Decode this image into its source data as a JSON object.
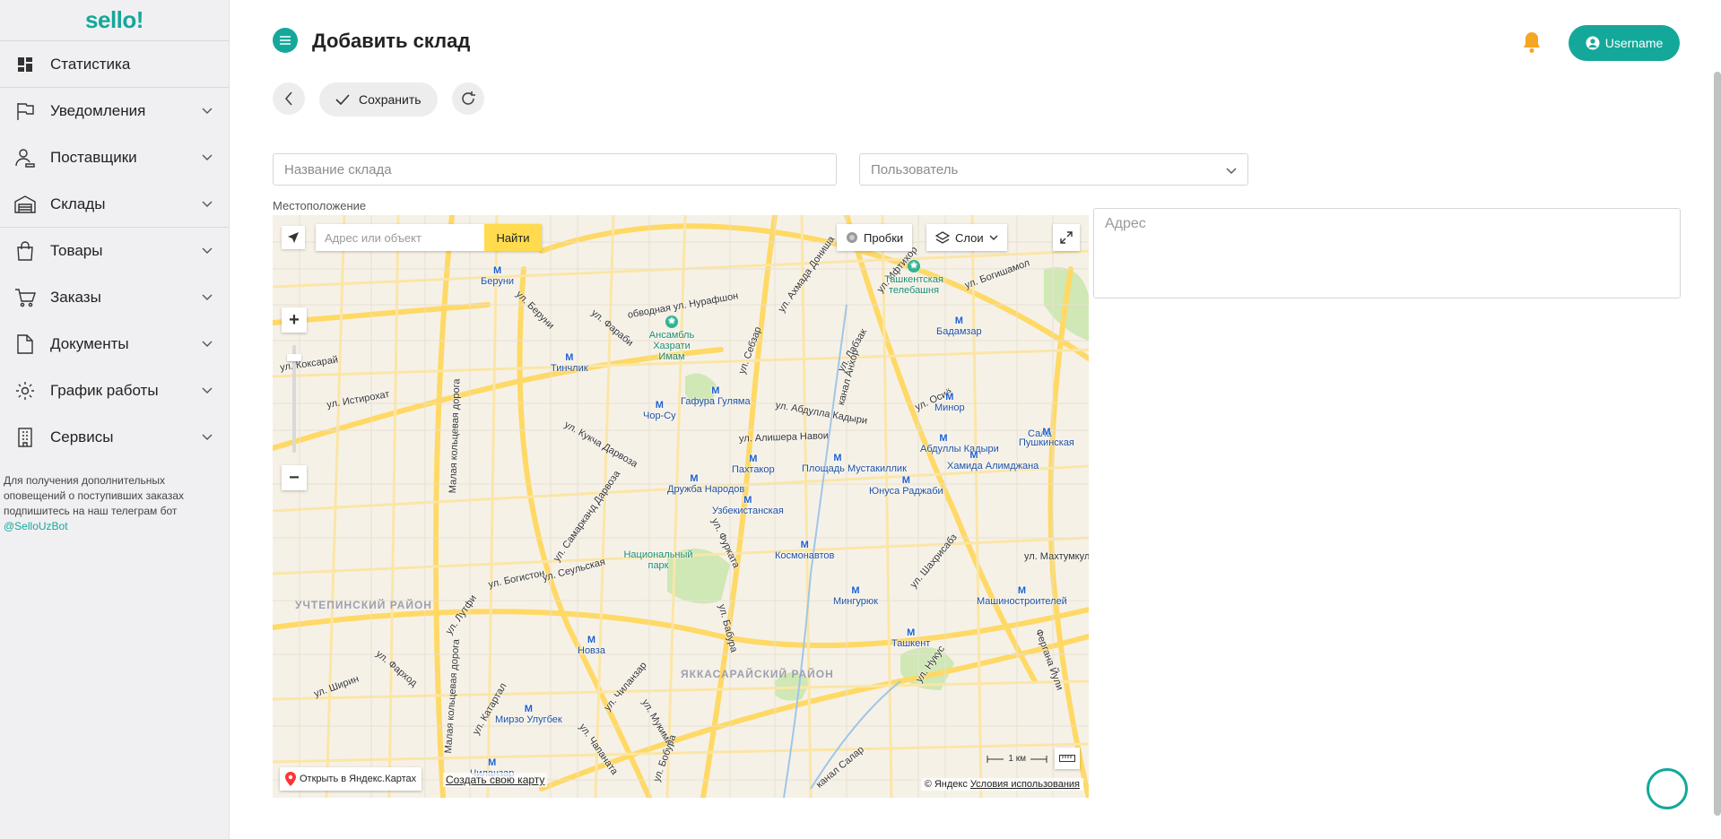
{
  "app": {
    "logo": "sello!"
  },
  "sidebar": {
    "items": [
      {
        "label": "Статистика",
        "icon": "dashboard-icon"
      },
      {
        "label": "Уведомления",
        "icon": "flag-icon"
      },
      {
        "label": "Поставщики",
        "icon": "user-hand-icon"
      },
      {
        "label": "Склады",
        "icon": "warehouse-icon"
      },
      {
        "label": "Товары",
        "icon": "shopping-bag-icon"
      },
      {
        "label": "Заказы",
        "icon": "cart-icon"
      },
      {
        "label": "Документы",
        "icon": "document-icon"
      },
      {
        "label": "График работы",
        "icon": "gear-icon"
      },
      {
        "label": "Сервисы",
        "icon": "building-icon"
      }
    ],
    "notice": "Для получения дополнительных оповещений о поступивших заказах подпишитесь на наш телеграм бот",
    "notice_link": "@SelloUzBot"
  },
  "header": {
    "title": "Добавить склад",
    "user_label": "Username"
  },
  "toolbar": {
    "save_label": "Сохранить"
  },
  "form": {
    "warehouse_name_placeholder": "Название склада",
    "user_placeholder": "Пользователь",
    "location_label": "Местоположение",
    "address_placeholder": "Адрес"
  },
  "map": {
    "search_placeholder": "Адрес или объект",
    "find_label": "Найти",
    "traffic_label": "Пробки",
    "layers_label": "Слои",
    "open_yandex": "Открыть в Яндекс.Картах",
    "create_map": "Создать свою карту",
    "copyright": "© Яндекс",
    "terms": "Условия использования",
    "scale": "1 км",
    "streets": [
      "Малая кольцевая дорога",
      "ул. Нурафшон",
      "ул. Ахмада Дониша",
      "ул. Себзар",
      "обводная ул. Нурафшон",
      "ул. Беруни",
      "ул. Фараби",
      "ул. Коксарай",
      "ул. Истирохат",
      "ул. Кукча Дарвоза",
      "ул. Абдулла Кадыри",
      "ул. Алишера Навои",
      "ул. Богистон",
      "ул. Лутфи",
      "ул. Ширин",
      "ул. Фарход",
      "ул. Катартал",
      "ул. Чиланзар",
      "ул. Мукими",
      "ул. Бабура",
      "ул. Нукус",
      "ул. Шахрисабз",
      "ул. Махтумкули",
      "ул. Богишамол",
      "ул. Осиё",
      "ул. Ифтихор",
      "ул. Лабзак",
      "ул. Фурката",
      "ул. Самарканд Дарвоза",
      "ул. Сеульская",
      "Малая кольцевая дорога",
      "ул. Чапаната",
      "ул. Бобура",
      "Фергана Йули",
      "канал Анхор",
      "канал Салар"
    ],
    "metro": [
      "Беруни",
      "Тинчлик",
      "Чор-Су",
      "Гафура Гуляма",
      "Бадамзар",
      "Минор",
      "Абдуллы Кадыри",
      "Площадь Мустакиллик",
      "Пахтакор",
      "Дружба Народов",
      "Узбекистанская",
      "Юнуса Раджаби",
      "Хамида Алимджана",
      "Пушкинская",
      "Космонавтов",
      "Мингурюк",
      "Машиностроителей",
      "Ташкент",
      "Новза",
      "Мирзо Улугбек",
      "Чиланзар"
    ],
    "landmarks": [
      "Ансамбль Хазрати Имам",
      "Ташкентская телебашня",
      "Национальный парк"
    ],
    "districts": [
      "УЧТЕПИНСКИЙ РАЙОН",
      "ЯККАСАРАЙСКИЙ РАЙОН"
    ],
    "partial_label": "Сала"
  },
  "colors": {
    "brand": "#14a89a",
    "bell": "#f5a623",
    "find_button": "#ffdb4d"
  }
}
